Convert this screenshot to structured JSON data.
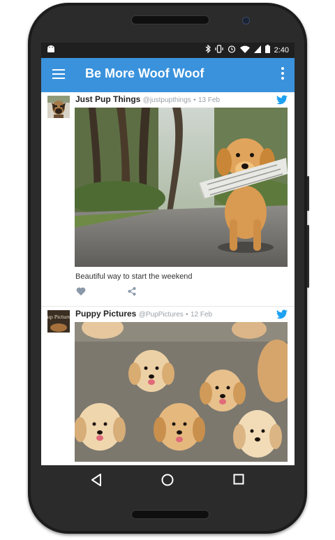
{
  "status_bar": {
    "time": "2:40"
  },
  "app_bar": {
    "title": "Be More Woof Woof"
  },
  "tweets": [
    {
      "name": "Just Pup Things",
      "handle": "@justpupthings",
      "separator": "•",
      "date": "13 Feb",
      "text": "Beautiful way to start the weekend"
    },
    {
      "name": "Puppy Pictures",
      "handle": "@PupPictures",
      "separator": "•",
      "date": "12 Feb",
      "avatar_text": "Pup Pictures"
    }
  ],
  "colors": {
    "app_bar": "#3a92dc",
    "twitter_blue": "#1da1f2",
    "status_bar": "#1f1f1f"
  }
}
